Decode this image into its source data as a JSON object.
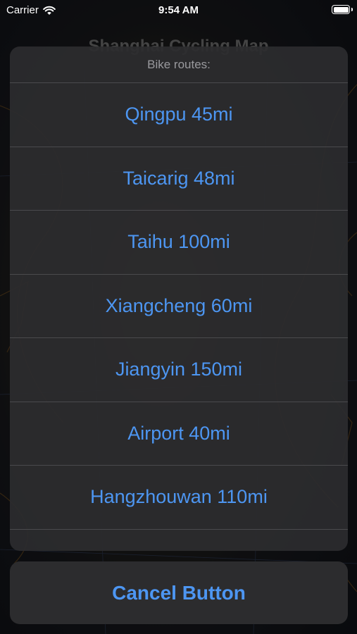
{
  "status_bar": {
    "carrier": "Carrier",
    "time": "9:54 AM"
  },
  "map": {
    "title": "Shanghai Cycling Map"
  },
  "action_sheet": {
    "header": "Bike routes:",
    "options": [
      {
        "label": "Qingpu 45mi"
      },
      {
        "label": "Taicarig 48mi"
      },
      {
        "label": "Taihu 100mi"
      },
      {
        "label": "Xiangcheng 60mi"
      },
      {
        "label": "Jiangyin 150mi"
      },
      {
        "label": "Airport 40mi"
      },
      {
        "label": "Hangzhouwan 110mi"
      }
    ],
    "cancel_label": "Cancel Button"
  },
  "colors": {
    "accent": "#4d96f2",
    "sheet_background": "#2c2c2e"
  }
}
